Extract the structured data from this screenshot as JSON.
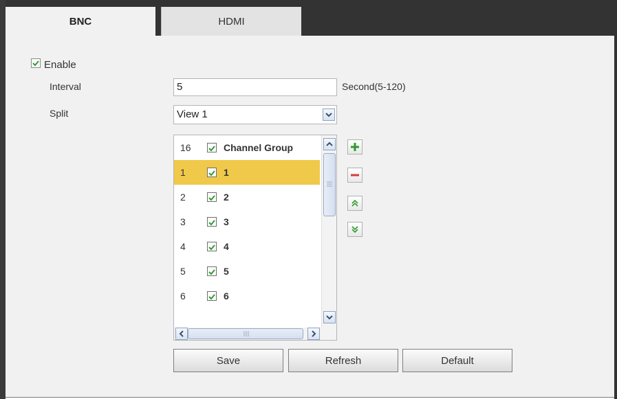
{
  "tabs": [
    {
      "label": "BNC",
      "active": true
    },
    {
      "label": "HDMI",
      "active": false
    }
  ],
  "enable": {
    "label": "Enable",
    "checked": true
  },
  "interval": {
    "label": "Interval",
    "value": "5",
    "hint": "Second(5-120)"
  },
  "split": {
    "label": "Split",
    "value": "View 1"
  },
  "channel_list": {
    "header": {
      "num": "16",
      "label": "Channel Group",
      "checked": true
    },
    "rows": [
      {
        "num": "1",
        "label": "1",
        "checked": true,
        "selected": true
      },
      {
        "num": "2",
        "label": "2",
        "checked": true,
        "selected": false
      },
      {
        "num": "3",
        "label": "3",
        "checked": true,
        "selected": false
      },
      {
        "num": "4",
        "label": "4",
        "checked": true,
        "selected": false
      },
      {
        "num": "5",
        "label": "5",
        "checked": true,
        "selected": false
      },
      {
        "num": "6",
        "label": "6",
        "checked": true,
        "selected": false
      }
    ]
  },
  "side_buttons": [
    "plus-icon",
    "minus-icon",
    "double-up-icon",
    "double-down-icon"
  ],
  "buttons": {
    "save": "Save",
    "refresh": "Refresh",
    "default": "Default"
  },
  "colors": {
    "selected_row": "#f0c94a",
    "check_green": "#2f9a2f",
    "minus_red": "#d63b3b"
  }
}
